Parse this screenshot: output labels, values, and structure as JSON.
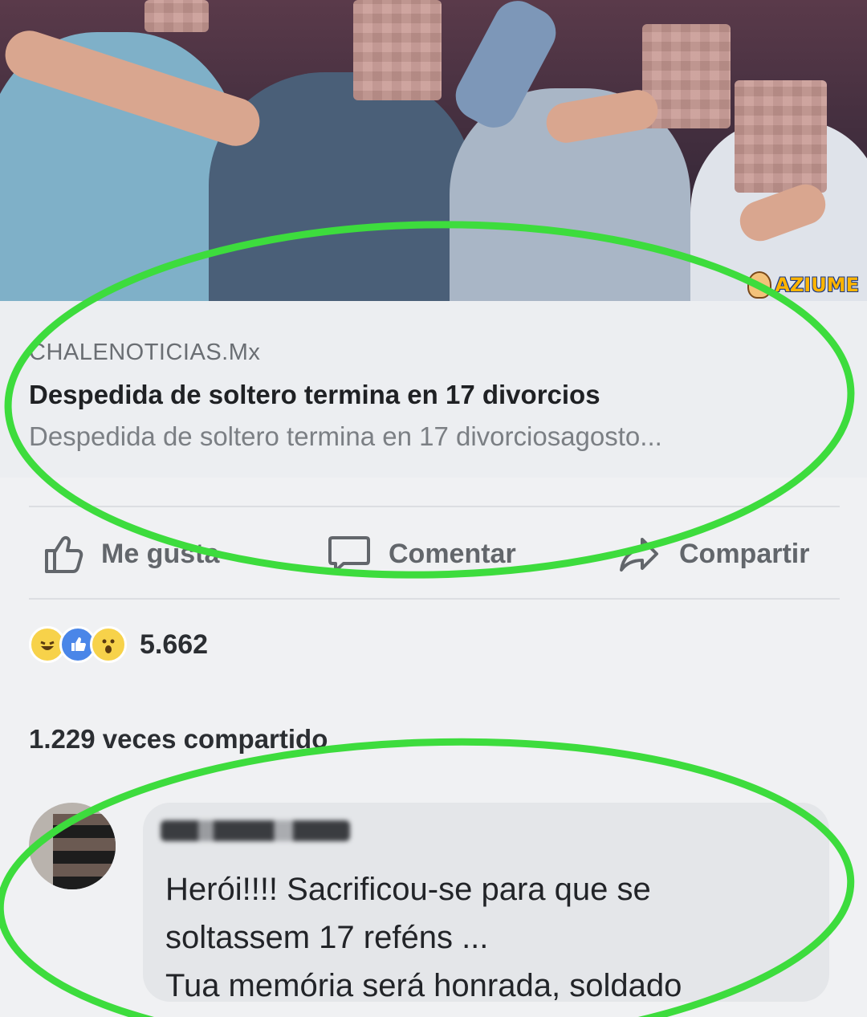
{
  "watermark": {
    "text": "AZIUME"
  },
  "link_preview": {
    "domain": "CHALENOTICIAS.Mx",
    "title": "Despedida de soltero termina en 17 divorcios",
    "description": "Despedida de soltero termina en 17 divorciosagosto..."
  },
  "actions": {
    "like_label": "Me gusta",
    "comment_label": "Comentar",
    "share_label": "Compartir"
  },
  "reactions": {
    "icons": [
      "haha-icon",
      "like-icon",
      "wow-icon"
    ],
    "count": "5.662"
  },
  "shares": {
    "count_text": "1.229 veces compartido"
  },
  "comment": {
    "lines": [
      "Herói!!!! Sacrificou-se para que se",
      "soltassem 17 reféns ...",
      "Tua memória será honrada, soldado"
    ]
  },
  "colors": {
    "highlight": "#3ddc3d",
    "like_blue": "#4a86e8",
    "reaction_yellow": "#f7d24a"
  }
}
